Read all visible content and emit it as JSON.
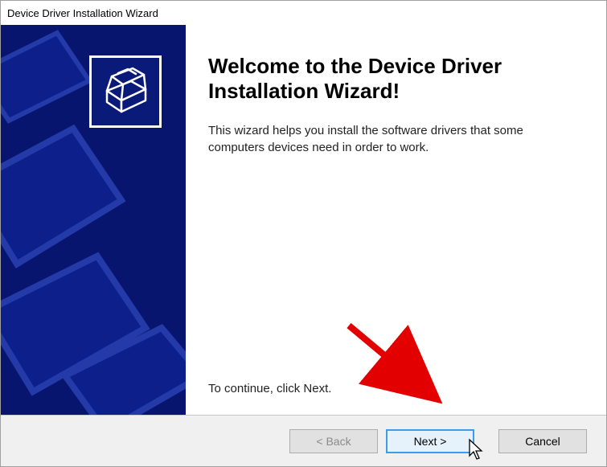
{
  "titlebar": {
    "title": "Device Driver Installation Wizard"
  },
  "heading": "Welcome to the Device Driver Installation Wizard!",
  "description": "This wizard helps you install the software drivers that some computers devices need in order to work.",
  "continue_text": "To continue, click Next.",
  "buttons": {
    "back_label": "< Back",
    "next_label": "Next >",
    "cancel_label": "Cancel"
  },
  "sidebar": {
    "icon": "install-drivers-icon"
  },
  "colors": {
    "accent_blue": "#07156e",
    "highlight_border": "#3e9be9"
  }
}
